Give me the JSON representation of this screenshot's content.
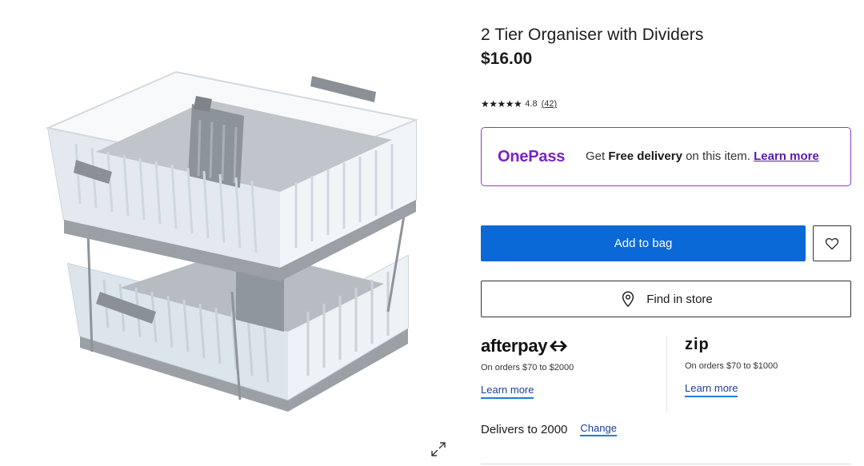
{
  "product": {
    "title": "2 Tier Organiser with Dividers",
    "price": "$16.00",
    "rating": {
      "stars": "★★★★★",
      "value": "4.8",
      "reviews": "(42)"
    },
    "image_icon": "expand-icon"
  },
  "onepass": {
    "logo": "OnePass",
    "text_prefix": "Get ",
    "text_bold": "Free delivery",
    "text_suffix": " on this item. ",
    "link": "Learn more",
    "color": "#7a22c4"
  },
  "actions": {
    "add_to_bag": "Add to bag",
    "add_to_bag_color": "#0a69d6",
    "wishlist_icon": "heart-icon",
    "find_in_store": "Find in store",
    "find_in_store_icon": "location-pin-icon"
  },
  "payments": {
    "afterpay": {
      "logo": "afterpay",
      "note": "On orders $70 to $2000",
      "link": "Learn more"
    },
    "zip": {
      "logo": "zip",
      "note": "On orders $70 to $1000",
      "link": "Learn more"
    }
  },
  "delivery": {
    "text": "Delivers to 2000",
    "change": "Change"
  }
}
